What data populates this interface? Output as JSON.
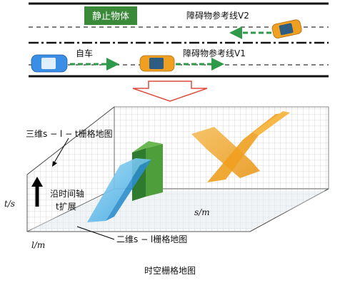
{
  "road": {
    "static_object_label": "静止物体",
    "obstacle_line_v2": "障碍物参考线V2",
    "obstacle_line_v1": "障碍物参考线V1",
    "ego_vehicle": "自车"
  },
  "grid3d": {
    "title_3d": "三维s − l − t栅格地图",
    "title_2d": "二维s − l栅格地图",
    "axis_t": "t/s",
    "axis_s": "s/m",
    "axis_l": "l/m",
    "time_axis_line1": "沿时间轴",
    "time_axis_line2": "t扩展"
  },
  "caption": "时空栅格地图",
  "colors": {
    "static_box": "#3b8a3a",
    "ego_car": "#3a8ee6",
    "obstacle_car": "#f0a020",
    "dashed_path": "#2e9a4a",
    "arrow_outline": "#e04a3a"
  }
}
